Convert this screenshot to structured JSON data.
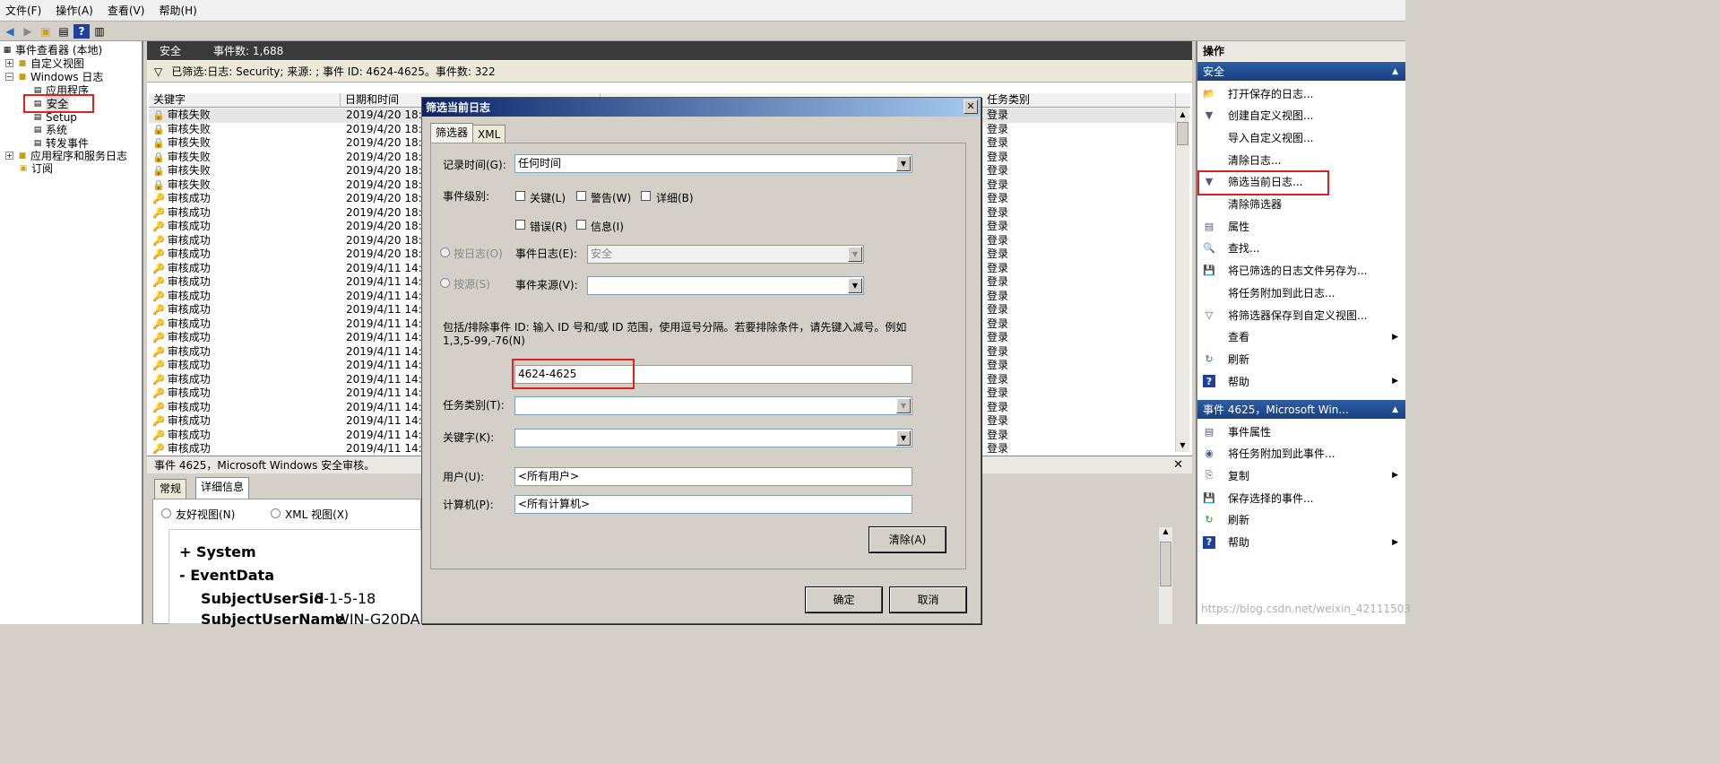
{
  "menu": [
    "文件(F)",
    "操作(A)",
    "查看(V)",
    "帮助(H)"
  ],
  "tree": {
    "root": "事件查看器 (本地)",
    "custom_views": "自定义视图",
    "windows_logs": "Windows 日志",
    "application": "应用程序",
    "security": "安全",
    "setup": "Setup",
    "system": "系统",
    "forwarded": "转发事件",
    "app_service_logs": "应用程序和服务日志",
    "subscriptions": "订阅"
  },
  "header": {
    "title": "安全",
    "count": "事件数: 1,688"
  },
  "filter_bar": "已筛选:日志: Security; 来源: ; 事件 ID: 4624-4625。事件数: 322",
  "columns": {
    "keyword": "关键字",
    "datetime": "日期和时间",
    "category": "任务类别"
  },
  "rows": [
    {
      "kw": "审核失败",
      "dt": "2019/4/20 18:",
      "cat": "登录",
      "fail": true
    },
    {
      "kw": "审核失败",
      "dt": "2019/4/20 18:",
      "cat": "登录",
      "fail": true
    },
    {
      "kw": "审核失败",
      "dt": "2019/4/20 18:",
      "cat": "登录",
      "fail": true
    },
    {
      "kw": "审核失败",
      "dt": "2019/4/20 18:",
      "cat": "登录",
      "fail": true
    },
    {
      "kw": "审核失败",
      "dt": "2019/4/20 18:",
      "cat": "登录",
      "fail": true
    },
    {
      "kw": "审核失败",
      "dt": "2019/4/20 18:",
      "cat": "登录",
      "fail": true
    },
    {
      "kw": "审核成功",
      "dt": "2019/4/20 18:",
      "cat": "登录",
      "fail": false
    },
    {
      "kw": "审核成功",
      "dt": "2019/4/20 18:",
      "cat": "登录",
      "fail": false
    },
    {
      "kw": "审核成功",
      "dt": "2019/4/20 18:",
      "cat": "登录",
      "fail": false
    },
    {
      "kw": "审核成功",
      "dt": "2019/4/20 18:",
      "cat": "登录",
      "fail": false
    },
    {
      "kw": "审核成功",
      "dt": "2019/4/20 18:",
      "cat": "登录",
      "fail": false
    },
    {
      "kw": "审核成功",
      "dt": "2019/4/11 14:",
      "cat": "登录",
      "fail": false
    },
    {
      "kw": "审核成功",
      "dt": "2019/4/11 14:",
      "cat": "登录",
      "fail": false
    },
    {
      "kw": "审核成功",
      "dt": "2019/4/11 14:",
      "cat": "登录",
      "fail": false
    },
    {
      "kw": "审核成功",
      "dt": "2019/4/11 14:",
      "cat": "登录",
      "fail": false
    },
    {
      "kw": "审核成功",
      "dt": "2019/4/11 14:",
      "cat": "登录",
      "fail": false
    },
    {
      "kw": "审核成功",
      "dt": "2019/4/11 14:",
      "cat": "登录",
      "fail": false
    },
    {
      "kw": "审核成功",
      "dt": "2019/4/11 14:",
      "cat": "登录",
      "fail": false
    },
    {
      "kw": "审核成功",
      "dt": "2019/4/11 14:",
      "cat": "登录",
      "fail": false
    },
    {
      "kw": "审核成功",
      "dt": "2019/4/11 14:",
      "cat": "登录",
      "fail": false
    },
    {
      "kw": "审核成功",
      "dt": "2019/4/11 14:",
      "cat": "登录",
      "fail": false
    },
    {
      "kw": "审核成功",
      "dt": "2019/4/11 14:",
      "cat": "登录",
      "fail": false
    },
    {
      "kw": "审核成功",
      "dt": "2019/4/11 14:",
      "cat": "登录",
      "fail": false
    },
    {
      "kw": "审核成功",
      "dt": "2019/4/11 14:",
      "cat": "登录",
      "fail": false
    },
    {
      "kw": "审核成功",
      "dt": "2019/4/11 14:",
      "cat": "登录",
      "fail": false
    }
  ],
  "detail": {
    "title": "事件 4625，Microsoft Windows 安全审核。",
    "tab_general": "常规",
    "tab_details": "详细信息",
    "radio_friendly": "友好视图(N)",
    "radio_xml": "XML 视图(X)",
    "system": "+ System",
    "eventdata": "- EventData",
    "sid_label": "SubjectUserSid",
    "sid_value": "S-1-5-18",
    "name_label": "SubjectUserName",
    "name_value": "WIN-G20DA"
  },
  "dialog": {
    "title": "筛选当前日志",
    "tab_filter": "筛选器",
    "tab_xml": "XML",
    "logged_label": "记录时间(G):",
    "logged_value": "任何时间",
    "level_label": "事件级别:",
    "critical": "关键(L)",
    "warning": "警告(W)",
    "verbose": "详细(B)",
    "error": "错误(R)",
    "info": "信息(I)",
    "by_log": "按日志(O)",
    "event_logs_label": "事件日志(E):",
    "event_logs_value": "安全",
    "by_source": "按源(S)",
    "source_label": "事件来源(V):",
    "desc1": "包括/排除事件 ID: 输入 ID 号和/或 ID 范围，使用逗号分隔。若要排除条件，请先键入减号。例如",
    "desc2": "1,3,5-99,-76(N)",
    "event_id_value": "4624-4625",
    "task_label": "任务类别(T):",
    "keywords_label": "关键字(K):",
    "user_label": "用户(U):",
    "user_value": "<所有用户>",
    "computer_label": "计算机(P):",
    "computer_value": "<所有计算机>",
    "clear_btn": "清除(A)",
    "ok_btn": "确定",
    "cancel_btn": "取消"
  },
  "actions": {
    "title": "操作",
    "section1": "安全",
    "items1": [
      {
        "label": "打开保存的日志...",
        "icon": "folder-icon",
        "sub": false
      },
      {
        "label": "创建自定义视图...",
        "icon": "filter-icon",
        "sub": false
      },
      {
        "label": "导入自定义视图...",
        "icon": "",
        "sub": false
      },
      {
        "label": "清除日志...",
        "icon": "",
        "sub": false
      },
      {
        "label": "筛选当前日志...",
        "icon": "filter-icon",
        "sub": false
      },
      {
        "label": "清除筛选器",
        "icon": "",
        "sub": false
      },
      {
        "label": "属性",
        "icon": "properties-icon",
        "sub": false
      },
      {
        "label": "查找...",
        "icon": "find-icon",
        "sub": false
      },
      {
        "label": "将已筛选的日志文件另存为...",
        "icon": "save-icon",
        "sub": false
      },
      {
        "label": "将任务附加到此日志...",
        "icon": "",
        "sub": false
      },
      {
        "label": "将筛选器保存到自定义视图...",
        "icon": "filter-save-icon",
        "sub": false
      },
      {
        "label": "查看",
        "icon": "",
        "sub": true
      },
      {
        "label": "刷新",
        "icon": "refresh-icon",
        "sub": false
      },
      {
        "label": "帮助",
        "icon": "help-icon",
        "sub": true
      }
    ],
    "section2": "事件 4625，Microsoft Win...",
    "items2": [
      {
        "label": "事件属性",
        "icon": "properties-icon",
        "sub": false
      },
      {
        "label": "将任务附加到此事件...",
        "icon": "task-icon",
        "sub": false
      },
      {
        "label": "复制",
        "icon": "copy-icon",
        "sub": true
      },
      {
        "label": "保存选择的事件...",
        "icon": "save-icon",
        "sub": false
      },
      {
        "label": "刷新",
        "icon": "refresh-icon",
        "sub": false
      },
      {
        "label": "帮助",
        "icon": "help-icon",
        "sub": true
      }
    ]
  },
  "watermark": "https://blog.csdn.net/weixin_42111503"
}
